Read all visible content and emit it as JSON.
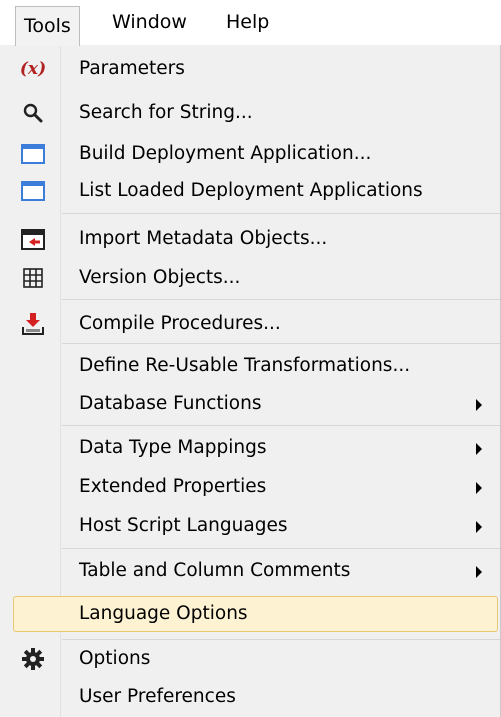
{
  "menubar": {
    "items": [
      {
        "label": "Tools"
      },
      {
        "label": "Window"
      },
      {
        "label": "Help"
      }
    ]
  },
  "menu": {
    "items": [
      {
        "label": "Parameters",
        "icon": "parameters-icon"
      },
      {
        "label": "Search for String...",
        "icon": "search-icon"
      },
      {
        "label": "Build Deployment Application...",
        "icon": "window-icon"
      },
      {
        "label": "List Loaded Deployment Applications",
        "icon": "window-icon"
      },
      {
        "label": "Import Metadata Objects...",
        "icon": "import-icon"
      },
      {
        "label": "Version Objects...",
        "icon": "grid-icon"
      },
      {
        "label": "Compile Procedures...",
        "icon": "compile-icon"
      },
      {
        "label": "Define Re-Usable Transformations..."
      },
      {
        "label": "Database Functions",
        "submenu": true
      },
      {
        "label": "Data Type Mappings",
        "submenu": true
      },
      {
        "label": "Extended Properties",
        "submenu": true
      },
      {
        "label": "Host Script Languages",
        "submenu": true
      },
      {
        "label": "Table and Column Comments",
        "submenu": true
      },
      {
        "label": "Language Options",
        "highlighted": true
      },
      {
        "label": "Options",
        "icon": "gear-icon"
      },
      {
        "label": "User Preferences"
      }
    ]
  },
  "colors": {
    "highlight_bg": "#fdf3d3",
    "highlight_border": "#e6c873",
    "menu_bg": "#f0f0f0",
    "icon_blue": "#3b7dd8",
    "icon_red": "#d42020"
  }
}
